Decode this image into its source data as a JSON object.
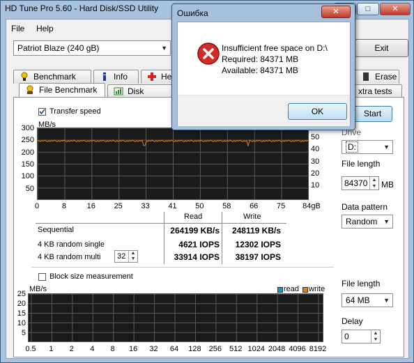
{
  "window": {
    "title": "HD Tune Pro 5.60 - Hard Disk/SSD Utility",
    "minimize": "–",
    "maximize": "□",
    "close": "✕"
  },
  "menu": {
    "file": "File",
    "help": "Help"
  },
  "drive_select": {
    "value": "Patriot Blaze (240 gB)"
  },
  "exit_label": "Exit",
  "tabs_top": [
    {
      "label": "Benchmark",
      "icon": "benchmark-icon"
    },
    {
      "label": "Info",
      "icon": "info-icon"
    },
    {
      "label": "He",
      "icon": "health-icon"
    },
    {
      "label": "Erase",
      "icon": "erase-icon"
    }
  ],
  "tabs_second": [
    {
      "label": "File Benchmark",
      "icon": "file-benchmark-icon"
    },
    {
      "label": "Disk monitor",
      "icon": "disk-monitor-icon"
    },
    {
      "label": "xtra tests"
    }
  ],
  "start_label": "Start",
  "transfer": {
    "checkbox_label": "Transfer speed",
    "checked": true,
    "unit": "MB/s",
    "y_left_ticks": [
      "300",
      "250",
      "200",
      "150",
      "100",
      "50"
    ],
    "y_right_ticks": [
      "50",
      "40",
      "30",
      "20",
      "10"
    ],
    "x_ticks": [
      "0",
      "8",
      "16",
      "25",
      "33",
      "41",
      "50",
      "58",
      "66",
      "75",
      "84gB"
    ]
  },
  "results": {
    "read_header": "Read",
    "write_header": "Write",
    "rows": [
      {
        "label": "Sequential",
        "read": "264199 KB/s",
        "write": "248119 KB/s"
      },
      {
        "label": "4 KB random single",
        "read": "4621 IOPS",
        "write": "12302 IOPS"
      },
      {
        "label": "4 KB random multi",
        "read": "33914 IOPS",
        "write": "38197 IOPS"
      }
    ],
    "queue_depth": "32"
  },
  "side": {
    "drive_label": "Drive",
    "drive_value": "D:",
    "file_length_label": "File length",
    "file_length_value": "84370",
    "file_length_unit": "MB",
    "pattern_label": "Data pattern",
    "pattern_value": "Random"
  },
  "block": {
    "checkbox_label": "Block size measurement",
    "checked": false,
    "unit": "MB/s",
    "legend_read": "read",
    "legend_write": "write",
    "y_ticks": [
      "25",
      "20",
      "15",
      "10",
      "5"
    ],
    "x_ticks": [
      "0.5",
      "1",
      "2",
      "4",
      "8",
      "16",
      "32",
      "64",
      "128",
      "256",
      "512",
      "1024",
      "2048",
      "4096",
      "8192"
    ],
    "file_length_label": "File length",
    "file_length_value": "64 MB",
    "delay_label": "Delay",
    "delay_value": "0"
  },
  "colors": {
    "read": "#1e90c8",
    "write": "#e07b1a",
    "grid": "#5a5a5a"
  },
  "dialog": {
    "title": "Ошибка",
    "close": "✕",
    "message_lines": [
      "Insufficient free space on D:\\",
      "Required: 84371 MB",
      "Available: 84371 MB"
    ],
    "ok_label": "OK",
    "icon": "error-icon"
  }
}
